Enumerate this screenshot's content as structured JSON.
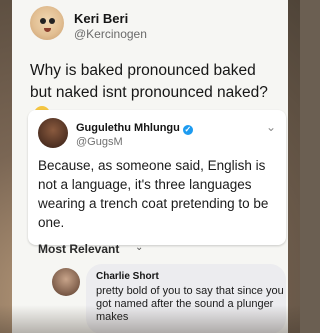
{
  "tweet": {
    "author_name": "Keri Beri",
    "author_handle": "@Kercinogen",
    "text": "Why is baked pronounced baked but naked isnt pronounced naked?",
    "emoji": "thinking-face-icon"
  },
  "quoted": {
    "author_name": "Gugulethu Mhlungu",
    "author_handle": "@GugsM",
    "verified": true,
    "text": "Because, as someone said, English is not a language, it's three languages wearing a trench coat pretending to be one."
  },
  "comments": {
    "sort_label": "Most Relevant",
    "items": [
      {
        "author_name": "Charlie Short",
        "text": "pretty bold of you to say that since you got named after the sound a plunger makes"
      }
    ]
  },
  "colors": {
    "card_bg": "#f6f6f3",
    "verified_blue": "#1d9bf0",
    "comment_bubble": "#ececef"
  }
}
